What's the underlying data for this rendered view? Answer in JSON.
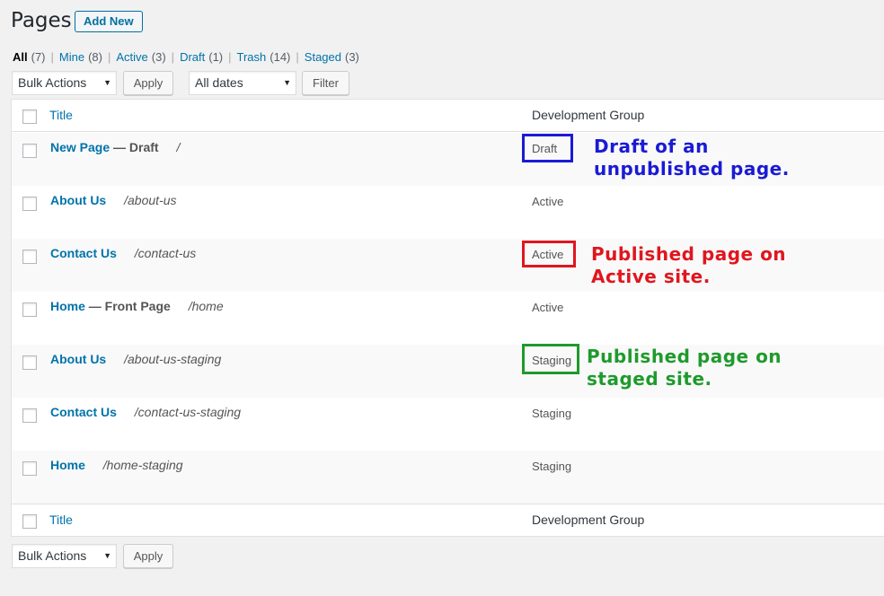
{
  "header": {
    "title": "Pages",
    "add_new_label": "Add New"
  },
  "filters": [
    {
      "label": "All",
      "count": "(7)",
      "current": true
    },
    {
      "label": "Mine",
      "count": "(8)"
    },
    {
      "label": "Active",
      "count": "(3)"
    },
    {
      "label": "Draft",
      "count": "(1)"
    },
    {
      "label": "Trash",
      "count": "(14)"
    },
    {
      "label": "Staged",
      "count": "(3)"
    }
  ],
  "separator": "|",
  "top_actions": {
    "bulk_actions": "Bulk Actions",
    "apply": "Apply",
    "dates": "All dates",
    "filter": "Filter"
  },
  "bottom_actions": {
    "bulk_actions": "Bulk Actions",
    "apply": "Apply"
  },
  "columns": {
    "title": "Title",
    "development_group": "Development Group"
  },
  "rows": [
    {
      "title": "New Page",
      "state": "— Draft",
      "path": "/",
      "group": "Draft"
    },
    {
      "title": "About Us",
      "state": "",
      "path": "/about-us",
      "group": "Active"
    },
    {
      "title": "Contact Us",
      "state": "",
      "path": "/contact-us",
      "group": "Active"
    },
    {
      "title": "Home",
      "state": "— Front Page",
      "path": "/home",
      "group": "Active"
    },
    {
      "title": "About Us",
      "state": "",
      "path": "/about-us-staging",
      "group": "Staging"
    },
    {
      "title": "Contact Us",
      "state": "",
      "path": "/contact-us-staging",
      "group": "Staging"
    },
    {
      "title": "Home",
      "state": "",
      "path": "/home-staging",
      "group": "Staging"
    }
  ],
  "annotations": [
    {
      "line1": "Draft of an",
      "line2": "unpublished page.",
      "color": "#1a1ad6"
    },
    {
      "line1": "Published page on",
      "line2": "Active site.",
      "color": "#e0161e"
    },
    {
      "line1": "Published page on",
      "line2": "staged site.",
      "color": "#1f9a2c"
    }
  ],
  "colors": {
    "link": "#0073aa",
    "background": "#f1f1f1"
  },
  "icons": {
    "select_arrow": "chevron-down-icon"
  },
  "glyphs": {
    "select_arrow": "▼"
  }
}
